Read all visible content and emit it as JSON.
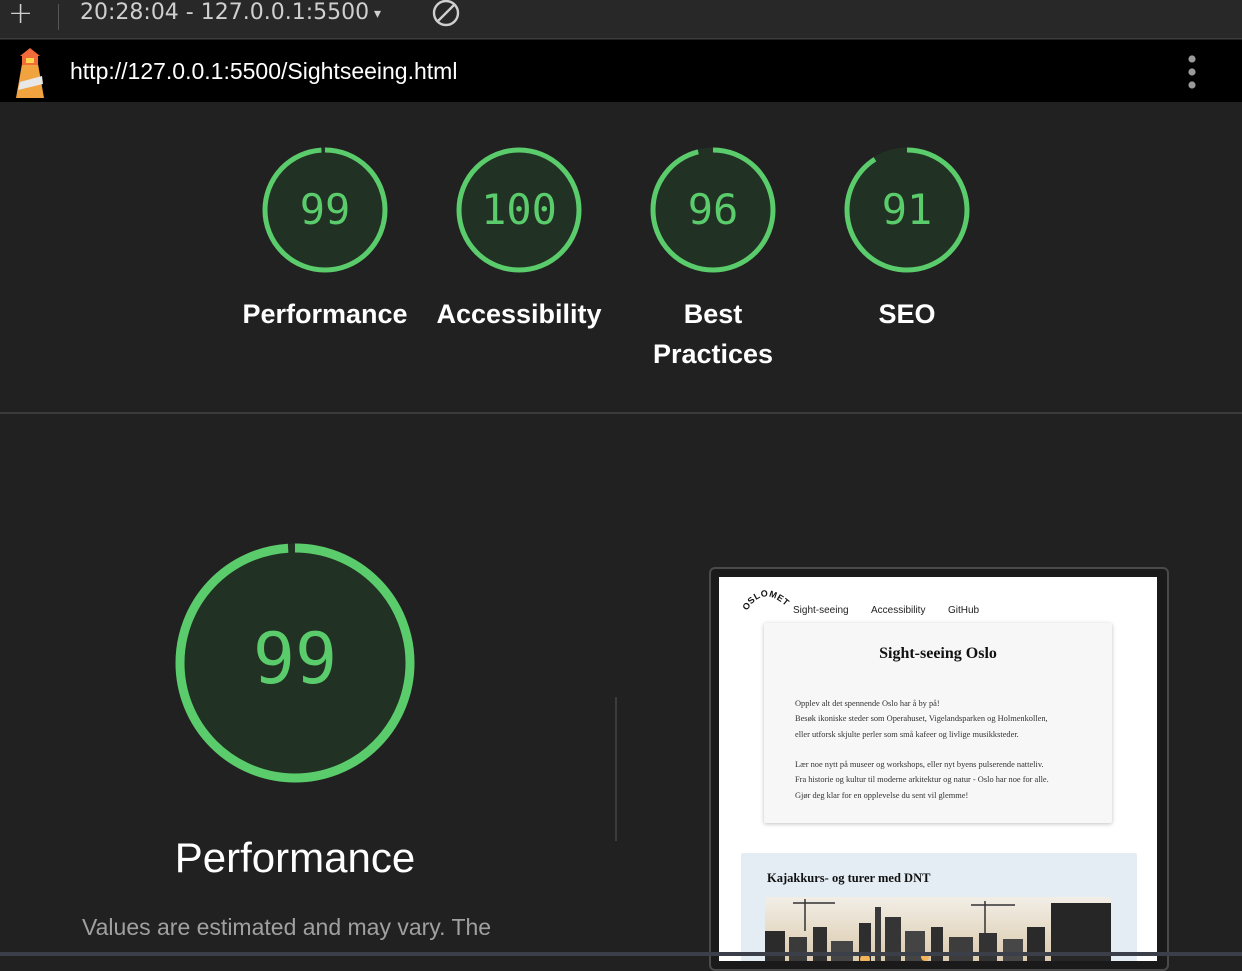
{
  "toolbar": {
    "plus": "+",
    "session": "20:28:04 - 127.0.0.1:5500",
    "caret": "▾",
    "icons": [
      "plus-icon",
      "chevron-down-icon",
      "block-icon"
    ]
  },
  "urlbar": {
    "url": "http://127.0.0.1:5500/Sightseeing.html",
    "icons": [
      "lighthouse-icon",
      "more-vert-icon"
    ]
  },
  "scores": [
    {
      "value": "99",
      "score": 99,
      "label": "Performance"
    },
    {
      "value": "100",
      "score": 100,
      "label": "Accessibility"
    },
    {
      "value": "96",
      "score": 96,
      "label": "Best Practices",
      "label_line1": "Best",
      "label_line2": "Practices"
    },
    {
      "value": "91",
      "score": 91,
      "label": "SEO"
    }
  ],
  "main": {
    "score": "99",
    "score_value": 99,
    "title": "Performance",
    "description": "Values are estimated and may vary. The"
  },
  "colors": {
    "pass": "#5bcc6c",
    "gauge_fill": "#213123",
    "background": "#212121"
  },
  "preview": {
    "logo": "OSLOMET",
    "nav": [
      "Sight-seeing",
      "Accessibility",
      "GitHub"
    ],
    "card_title": "Sight-seeing Oslo",
    "para1": [
      "Opplev alt det spennende Oslo har å by på!",
      "Besøk ikoniske steder som Operahuset, Vigelandsparken og Holmenkollen,",
      "eller utforsk skjulte perler som små kafeer og livlige musikksteder."
    ],
    "para2": [
      "Lær noe nytt på museer og workshops, eller nyt byens pulserende natteliv.",
      "Fra historie og kultur til moderne arkitektur og natur - Oslo har noe for alle.",
      "Gjør deg klar for en opplevelse du sent vil glemme!"
    ],
    "card2_title": "Kajakkurs- og turer med DNT"
  }
}
